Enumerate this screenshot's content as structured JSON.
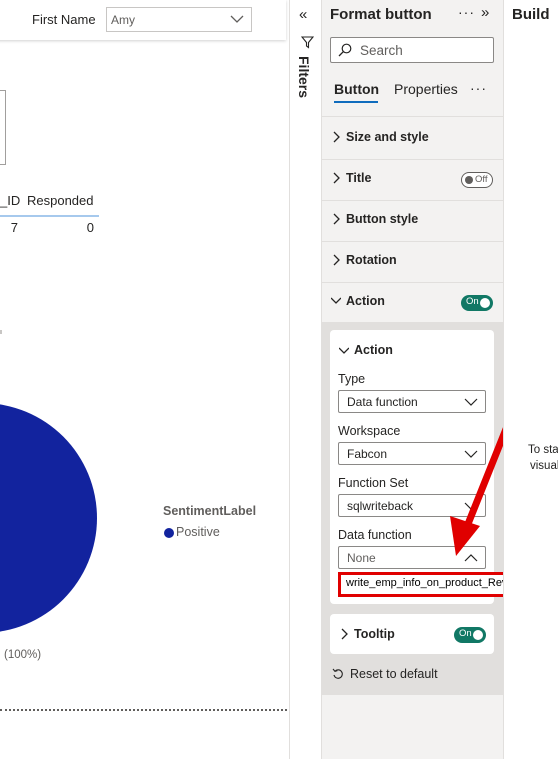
{
  "canvas": {
    "slicer": {
      "label": "First Name",
      "value": "Amy"
    },
    "table": {
      "headers": [
        "_ID",
        "Responded"
      ],
      "rows": [
        [
          "7",
          "0"
        ]
      ]
    },
    "pie": {
      "data_label": "(100%)",
      "color": "#12239e"
    },
    "legend": {
      "title": "SentimentLabel",
      "items": [
        {
          "label": "Positive",
          "color": "#12239e"
        }
      ]
    }
  },
  "filters_pane": {
    "label": "Filters",
    "collapse_icon": "double-chevron-left-icon",
    "funnel_icon": "funnel-icon"
  },
  "format_pane": {
    "title": "Format button",
    "more": "···",
    "expand_icon": "double-chevron-right-icon",
    "search_placeholder": "Search",
    "tabs": [
      {
        "label": "Button",
        "active": true
      },
      {
        "label": "Properties",
        "active": false
      }
    ],
    "tabs_more": "···",
    "sections": [
      {
        "label": "Size and style",
        "expanded": false
      },
      {
        "label": "Title",
        "expanded": false,
        "toggle": "Off"
      },
      {
        "label": "Button style",
        "expanded": false
      },
      {
        "label": "Rotation",
        "expanded": false
      },
      {
        "label": "Action",
        "expanded": true,
        "toggle": "On"
      }
    ],
    "action_card": {
      "header": "Action",
      "fields": [
        {
          "label": "Type",
          "value": "Data function"
        },
        {
          "label": "Workspace",
          "value": "Fabcon"
        },
        {
          "label": "Function Set",
          "value": "sqlwriteback"
        },
        {
          "label": "Data function",
          "value": "None",
          "open": true
        }
      ],
      "open_option": "write_emp_info_on_product_Review"
    },
    "tooltip_section": {
      "label": "Tooltip",
      "toggle": "On"
    },
    "reset_label": "Reset to default",
    "accent_toggle_on": "#117865",
    "annotation_color": "#e00000"
  },
  "build_pane": {
    "title": "Build",
    "hint_line_1": "To sta",
    "hint_line_2": "visual"
  }
}
